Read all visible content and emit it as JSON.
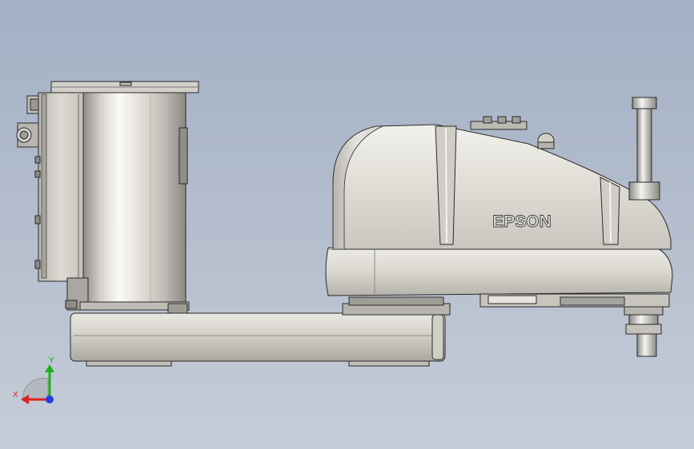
{
  "model": {
    "brand_label": "EPSON"
  },
  "triad": {
    "x_label": "X",
    "y_label": "Y",
    "colors": {
      "x": "#e02020",
      "y": "#20b020",
      "z": "#2040e0"
    }
  },
  "palette": {
    "background_top": "#a3b0c4",
    "background_bottom": "#c6cdd8",
    "body_light": "#e6e4dc",
    "body_mid": "#cfcdc4",
    "body_dark": "#9c9a92",
    "edge": "#2a2a2a"
  }
}
